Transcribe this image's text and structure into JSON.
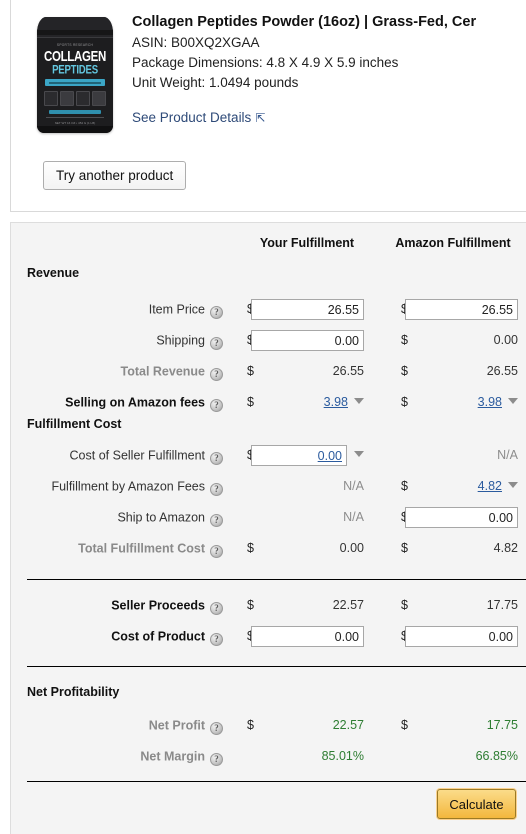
{
  "product": {
    "title": "Collagen Peptides Powder (16oz) | Grass-Fed, Cer",
    "asin_line": "ASIN: B00XQ2XGAA",
    "package_dimensions_line": "Package Dimensions: 4.8 X 4.9 X 5.9 inches",
    "unit_weight_line": "Unit Weight: 1.0494 pounds",
    "see_details_label": "See Product Details",
    "popout_icon": "⇱",
    "try_another_label": "Try another product",
    "image": {
      "brand": "SPORTS RESEARCH",
      "line1": "COLLAGEN",
      "line2": "PEPTIDES",
      "band": "HYDROLYZED TYPE I & III COLLAGEN",
      "footer_band": "UNFLAVORED",
      "bottom_text": "NET WT 16 OZ  •  454 G (1 LB)"
    }
  },
  "calculator": {
    "columns": {
      "your": "Your Fulfillment",
      "amazon": "Amazon Fulfillment"
    },
    "help_glyph": "?",
    "caret_glyph": "▼",
    "sections": {
      "revenue": "Revenue",
      "fulfillment_cost": "Fulfillment Cost",
      "net_profitability": "Net Profitability"
    },
    "rows": {
      "item_price": {
        "label": "Item Price",
        "your": "26.55",
        "amazon": "26.55"
      },
      "shipping": {
        "label": "Shipping",
        "your": "0.00",
        "amazon": "0.00"
      },
      "total_revenue": {
        "label": "Total Revenue",
        "your": "26.55",
        "amazon": "26.55"
      },
      "selling_fees": {
        "label": "Selling on Amazon fees",
        "your": "3.98",
        "amazon": "3.98"
      },
      "cost_seller_fulfillment": {
        "label": "Cost of Seller Fulfillment",
        "your": "0.00",
        "amazon": "N/A"
      },
      "fba_fees": {
        "label": "Fulfillment by Amazon Fees",
        "your": "N/A",
        "amazon": "4.82"
      },
      "ship_to_amazon": {
        "label": "Ship to Amazon",
        "your": "N/A",
        "amazon": "0.00"
      },
      "total_fulfillment_cost": {
        "label": "Total Fulfillment Cost",
        "your": "0.00",
        "amazon": "4.82"
      },
      "seller_proceeds": {
        "label": "Seller Proceeds",
        "your": "22.57",
        "amazon": "17.75"
      },
      "cost_of_product": {
        "label": "Cost of Product",
        "your": "0.00",
        "amazon": "0.00"
      },
      "net_profit": {
        "label": "Net Profit",
        "your": "22.57",
        "amazon": "17.75"
      },
      "net_margin": {
        "label": "Net Margin",
        "your": "85.01%",
        "amazon": "66.85%"
      }
    },
    "currency_symbol": "$",
    "calculate_label": "Calculate"
  },
  "colors": {
    "link": "#2b5b9e",
    "positive": "#2e7d32",
    "muted": "#8d8d8d",
    "panel_bg": "#f4f4f4",
    "button_accent": "#f3b73d"
  }
}
